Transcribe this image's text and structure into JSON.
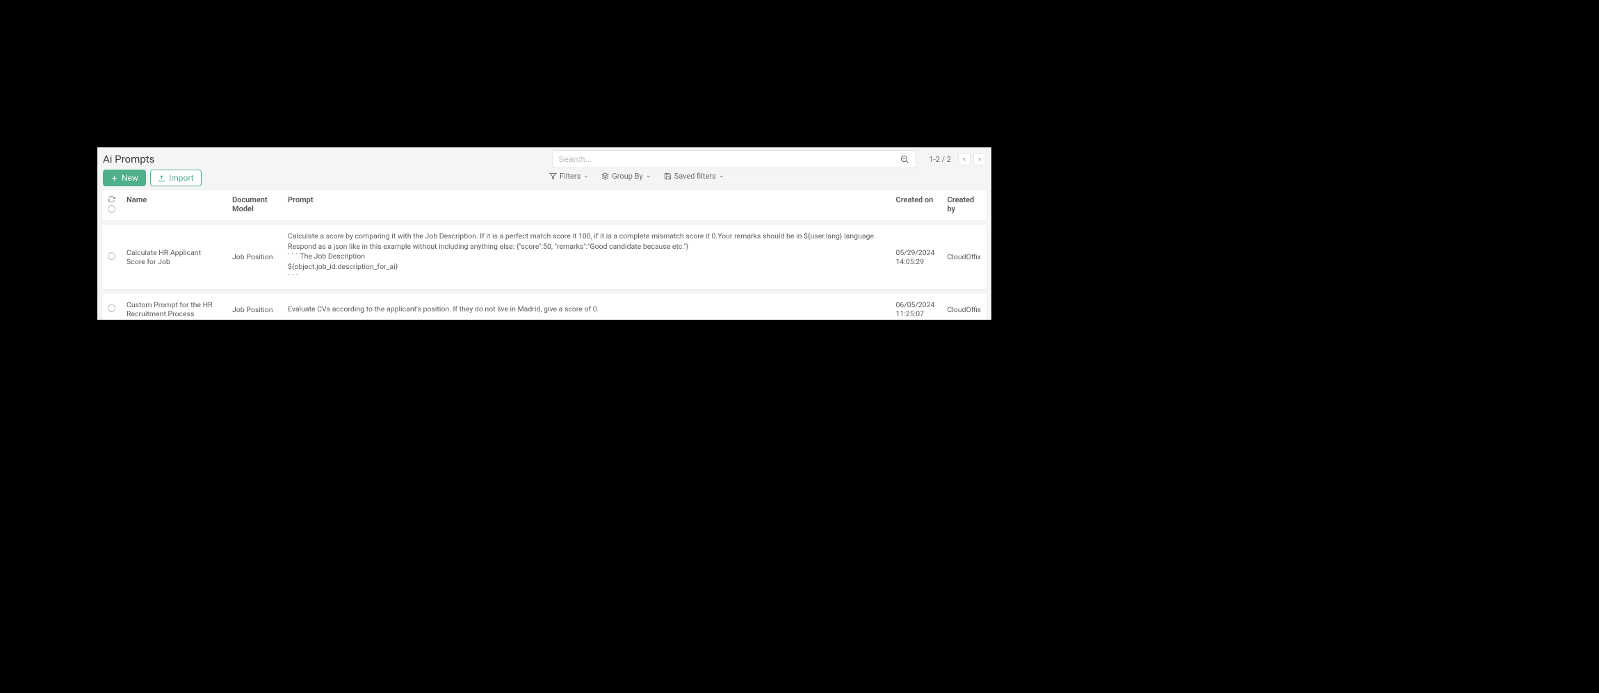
{
  "page": {
    "title": "Ai Prompts"
  },
  "toolbar": {
    "new_label": "New",
    "import_label": "Import"
  },
  "search": {
    "placeholder": "Search..."
  },
  "filters": {
    "filters_label": "Filters",
    "groupby_label": "Group By",
    "saved_label": "Saved filters"
  },
  "pager": {
    "range": "1-2 / 2"
  },
  "columns": {
    "name": "Name",
    "document_model": "Document Model",
    "prompt": "Prompt",
    "created_on": "Created on",
    "created_by": "Created by"
  },
  "rows": [
    {
      "name": "Calculate HR Applicant Score for Job",
      "document_model": "Job Position",
      "prompt": "Calculate a score by comparing it with the Job Description. If it is a perfect match score it 100, if it is a complete mismatch score it 0.Your remarks should be in ${user.lang} language. Respond as a json like in this example without including anything else: {\"score\":50, \"remarks\":\"Good candidate because etc.\"}\n` ` ` The Job Description\n${object.job_id.description_for_ai}\n` ` `",
      "created_on": "05/29/2024 14:05:29",
      "created_by": "CloudOffix"
    },
    {
      "name": "Custom Prompt for the HR Recruitment Process",
      "document_model": "Job Position",
      "prompt": "Evaluate CVs according to the applicant's position. If they do not live in Madrid, give a score of 0.",
      "created_on": "06/05/2024 11:25:07",
      "created_by": "CloudOffix"
    }
  ]
}
